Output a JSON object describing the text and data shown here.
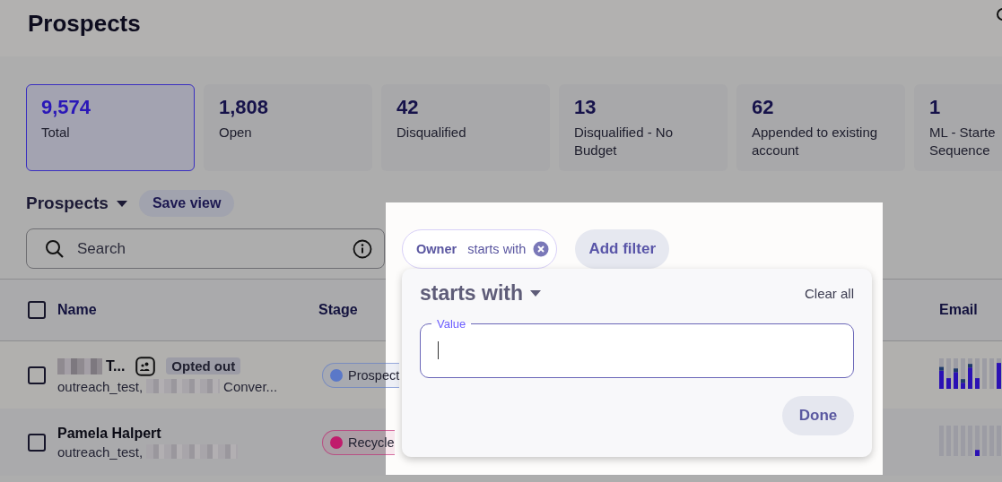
{
  "page_title": "Prospects",
  "stat_cards": [
    {
      "value": "9,574",
      "label_lines": [
        "Total"
      ],
      "selected": true
    },
    {
      "value": "1,808",
      "label_lines": [
        "Open"
      ],
      "selected": false
    },
    {
      "value": "42",
      "label_lines": [
        "Disqualified"
      ],
      "selected": false
    },
    {
      "value": "13",
      "label_lines": [
        "Disqualified - No",
        "Budget"
      ],
      "selected": false
    },
    {
      "value": "62",
      "label_lines": [
        "Appended to existing",
        "account"
      ],
      "selected": false
    },
    {
      "value": "1",
      "label_lines": [
        "ML - Starte",
        "Sequence"
      ],
      "selected": false
    }
  ],
  "view": {
    "name": "Prospects",
    "save_button": "Save view"
  },
  "search": {
    "placeholder": "Search"
  },
  "filter_chip": {
    "field": "Owner",
    "operator": "starts with"
  },
  "add_filter": "Add filter",
  "popover": {
    "operator": "starts with",
    "clear_all": "Clear all",
    "field_label": "Value",
    "done": "Done"
  },
  "table": {
    "header_checked": false,
    "columns": [
      "Name",
      "Stage",
      "Email"
    ],
    "rows": [
      {
        "checked": false,
        "name": "T...",
        "name_redacted": true,
        "group_icon": true,
        "badge": "Opted out",
        "subtitle": "outreach_test,",
        "subtitle_tail": "Conver...",
        "stage": "Prospect",
        "color": "#5a78c8"
      },
      {
        "checked": false,
        "name": "Pamela Halpert",
        "name_redacted": false,
        "group_icon": false,
        "subtitle": "outreach_test,",
        "stage": "Recycle",
        "color": "#c01c6c"
      }
    ]
  }
}
